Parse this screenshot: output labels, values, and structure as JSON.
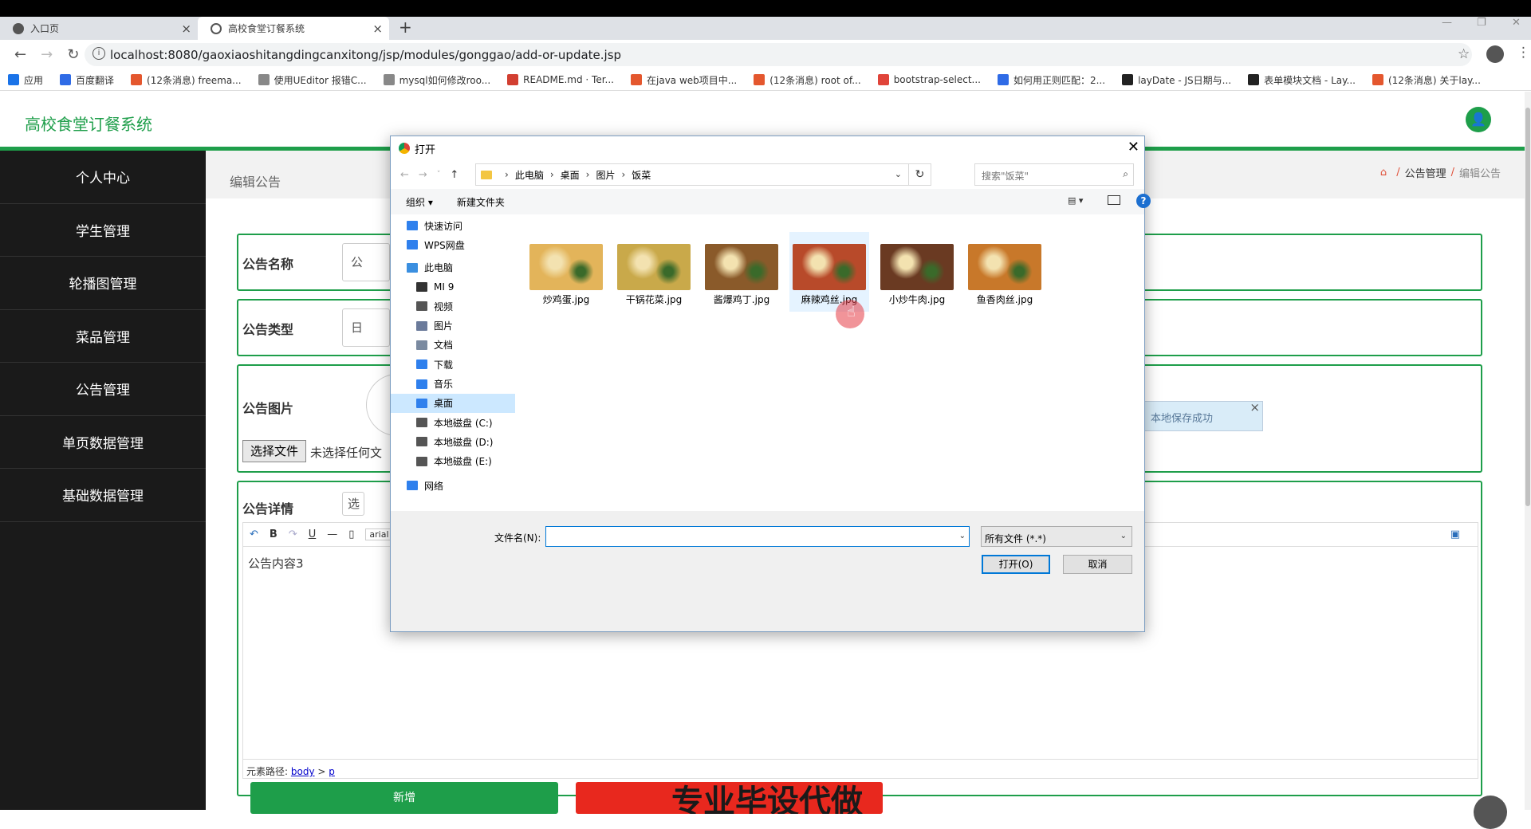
{
  "browser": {
    "tabs": [
      {
        "label": "入口页"
      },
      {
        "label": "高校食堂订餐系统"
      }
    ],
    "url": "localhost:8080/gaoxiaoshitangdingcanxitong/jsp/modules/gonggao/add-or-update.jsp",
    "bookmarks": [
      {
        "label": "应用",
        "color": "#1a73e8"
      },
      {
        "label": "百度翻译",
        "color": "#2f6be6"
      },
      {
        "label": "(12条消息) freema...",
        "color": "#e4572e"
      },
      {
        "label": "使用UEditor 报错C...",
        "color": "#888888"
      },
      {
        "label": "mysql如何修改roo...",
        "color": "#888888"
      },
      {
        "label": "README.md · Ter...",
        "color": "#d23f31"
      },
      {
        "label": "在java web项目中...",
        "color": "#e4572e"
      },
      {
        "label": "(12条消息) root of...",
        "color": "#e4572e"
      },
      {
        "label": "bootstrap-select...",
        "color": "#e0443a"
      },
      {
        "label": "如何用正则匹配：2...",
        "color": "#2f6be6"
      },
      {
        "label": "layDate - JS日期与...",
        "color": "#222222"
      },
      {
        "label": "表单模块文档 - Lay...",
        "color": "#222222"
      },
      {
        "label": "(12条消息) 关于lay...",
        "color": "#e4572e"
      }
    ]
  },
  "app": {
    "title": "高校食堂订餐系统",
    "accent": "#1e9e4a",
    "sidebar": [
      {
        "label": "个人中心"
      },
      {
        "label": "学生管理"
      },
      {
        "label": "轮播图管理"
      },
      {
        "label": "菜品管理"
      },
      {
        "label": "公告管理"
      },
      {
        "label": "单页数据管理"
      },
      {
        "label": "基础数据管理"
      }
    ],
    "page_title": "编辑公告",
    "breadcrumb": {
      "home_icon": "home-icon",
      "section": "公告管理",
      "current": "编辑公告"
    },
    "form": {
      "name_label": "公告名称",
      "name_value": "公",
      "type_label": "公告类型",
      "type_value": "日",
      "image_label": "公告图片",
      "choose_file": "选择文件",
      "no_file": "未选择任何文",
      "detail_label": "公告详情",
      "detail_btn": "选",
      "editor_font": "arial",
      "editor_content": "公告内容3",
      "editor_path_label": "元素路径:",
      "editor_path_body": "body",
      "editor_path_sep": ">",
      "editor_path_p": "p"
    },
    "toast": "本地保存成功",
    "add_button": "新增",
    "ad_banner": "专业毕设代做"
  },
  "dialog": {
    "title": "打开",
    "address": [
      "此电脑",
      "桌面",
      "图片",
      "饭菜"
    ],
    "search_placeholder": "搜索\"饭菜\"",
    "cmd_organize": "组织",
    "cmd_new_folder": "新建文件夹",
    "tree": [
      {
        "label": "快速访问",
        "color": "#2f80ed"
      },
      {
        "label": "WPS网盘",
        "color": "#2f80ed"
      },
      {
        "label": "此电脑",
        "color": "#3a8fe0"
      },
      {
        "label": "MI 9",
        "color": "#333333"
      },
      {
        "label": "视频",
        "color": "#555555"
      },
      {
        "label": "图片",
        "color": "#6a7a9a"
      },
      {
        "label": "文档",
        "color": "#7a8aa0"
      },
      {
        "label": "下载",
        "color": "#2f80ed"
      },
      {
        "label": "音乐",
        "color": "#2f80ed"
      },
      {
        "label": "桌面",
        "color": "#2f80ed"
      },
      {
        "label": "本地磁盘 (C:)",
        "color": "#555555"
      },
      {
        "label": "本地磁盘 (D:)",
        "color": "#555555"
      },
      {
        "label": "本地磁盘 (E:)",
        "color": "#555555"
      },
      {
        "label": "网络",
        "color": "#2f80ed"
      }
    ],
    "files": [
      {
        "name": "炒鸡蛋.jpg",
        "color": "#e3b45a"
      },
      {
        "name": "干锅花菜.jpg",
        "color": "#c9a94a"
      },
      {
        "name": "酱爆鸡丁.jpg",
        "color": "#8a5a2a"
      },
      {
        "name": "麻辣鸡丝.jpg",
        "color": "#b84a2a"
      },
      {
        "name": "小炒牛肉.jpg",
        "color": "#6a3a22"
      },
      {
        "name": "鱼香肉丝.jpg",
        "color": "#c8782a"
      }
    ],
    "filename_label": "文件名(N):",
    "filename_value": "",
    "filetype": "所有文件 (*.*)",
    "open_button": "打开(O)",
    "cancel_button": "取消"
  }
}
